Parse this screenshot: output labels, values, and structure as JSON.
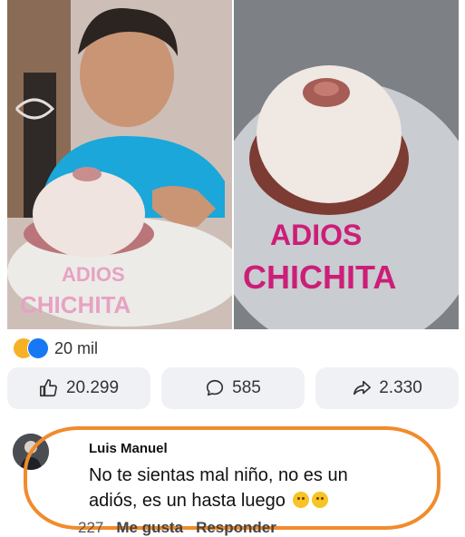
{
  "photos": {
    "left_cake_text": [
      "ADIOS",
      "CHICHITA"
    ],
    "right_cake_text": [
      "ADIOS",
      "CHICHITA"
    ]
  },
  "reactions": {
    "icons": [
      "haha-icon",
      "like-icon"
    ],
    "count_label": "20 mil"
  },
  "actions": {
    "like_count": "20.299",
    "comment_count": "585",
    "share_count": "2.330"
  },
  "comment": {
    "author": "Luis Manuel",
    "text": "No te sientas mal niño, no es un adiós, es un hasta luego",
    "reaction_count": "227",
    "like_label": "Me gusta",
    "reply_label": "Responder"
  },
  "colors": {
    "like_blue": "#1877f2",
    "haha_yellow": "#f7b125",
    "highlight_orange": "#f18b2c",
    "pill_gray": "#eff1f4"
  }
}
